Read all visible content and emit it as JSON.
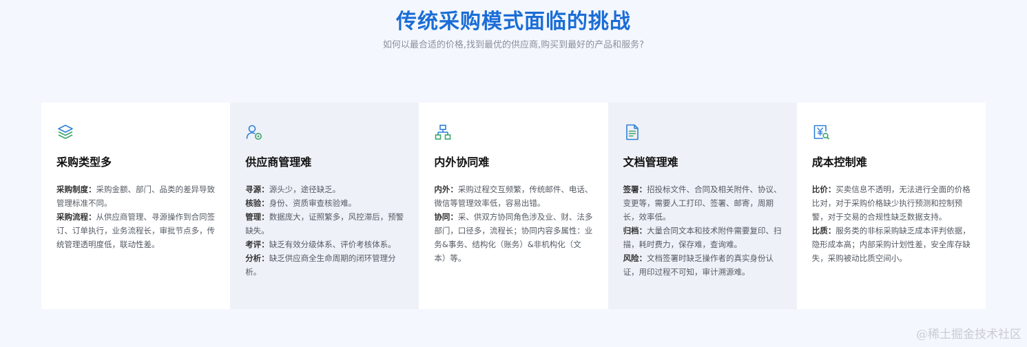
{
  "header": {
    "title": "传统采购模式面临的挑战",
    "subtitle": "如何以最合适的价格,找到最优的供应商,购买到最好的产品和服务?"
  },
  "cards": [
    {
      "icon": "layers-icon",
      "title": "采购类型多",
      "lines": [
        {
          "label": "采购制度：",
          "text": "采购金额、部门、品类的差异导致管理标准不同。"
        },
        {
          "label": "采购流程：",
          "text": "从供应商管理、寻源操作到合同签订、订单执行，业务流程长，审批节点多，传统管理透明度低，联动性差。"
        }
      ]
    },
    {
      "icon": "supplier-settings-icon",
      "title": "供应商管理难",
      "lines": [
        {
          "label": "寻源：",
          "text": "源头少，途径缺乏。"
        },
        {
          "label": "核验：",
          "text": "身份、资质审查核验难。"
        },
        {
          "label": "管理：",
          "text": "数据庞大，证照繁多，风控滞后，预警缺失。"
        },
        {
          "label": "考评：",
          "text": "缺乏有效分级体系、评价考核体系。"
        },
        {
          "label": "分析：",
          "text": "缺乏供应商全生命周期的闭环管理分析。"
        }
      ]
    },
    {
      "icon": "org-chart-icon",
      "title": "内外协同难",
      "lines": [
        {
          "label": "内外：",
          "text": "采购过程交互频繁，传统邮件、电话、微信等管理效率低，容易出错。"
        },
        {
          "label": "协同：",
          "text": "采、供双方协同角色涉及业、财、法多部门，口径多，流程长；协同内容多属性：业务&事务、结构化（账务）&非机构化（文本）等。"
        }
      ]
    },
    {
      "icon": "document-icon",
      "title": "文档管理难",
      "lines": [
        {
          "label": "签署：",
          "text": "招投标文件、合同及相关附件、协议、变更等，需要人工打印、签署、邮寄，周期长，效率低。"
        },
        {
          "label": "归档：",
          "text": "大量合同文本和技术附件需要复印、扫描，耗时费力，保存难，查询难。"
        },
        {
          "label": "风险：",
          "text": "文档签署时缺乏操作者的真实身份认证，用印过程不可知，审计溯源难。"
        }
      ]
    },
    {
      "icon": "cost-search-icon",
      "title": "成本控制难",
      "lines": [
        {
          "label": "比价：",
          "text": "买卖信息不透明，无法进行全面的价格比对，对于采购价格缺少执行预测和控制预警，对于交易的合规性缺乏数据支持。"
        },
        {
          "label": "比质：",
          "text": "服务类的非标采购缺乏成本评判依据，隐形成本高；内部采购计划性差，安全库存缺失，采购被动比质空间小。"
        }
      ]
    }
  ],
  "watermark": "@稀土掘金技术社区",
  "colors": {
    "title_blue": "#1a6dd6",
    "icon_green": "#3aa56b",
    "icon_blue": "#2f7fd8",
    "background": "#f4f7fd"
  }
}
